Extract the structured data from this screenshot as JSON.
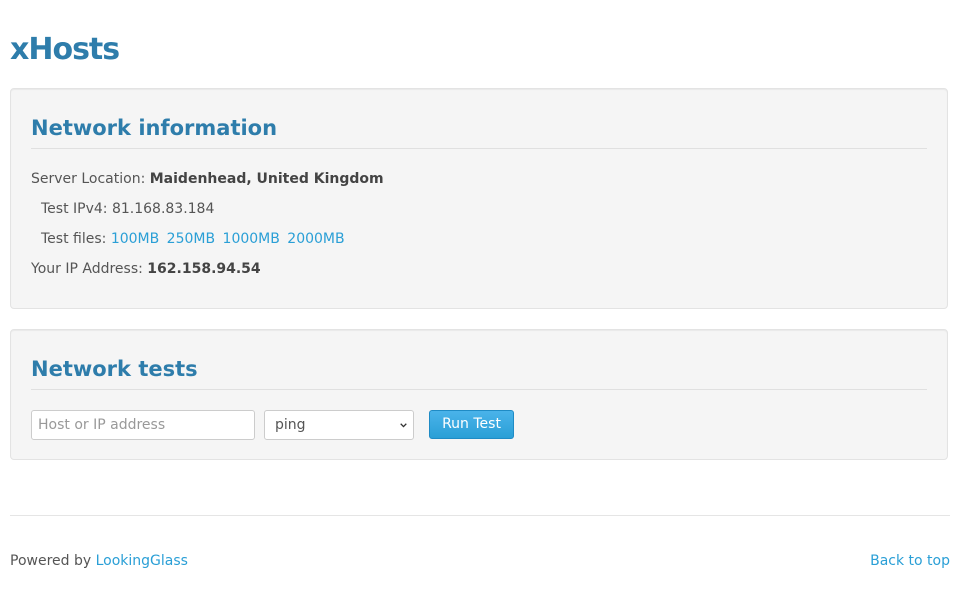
{
  "brand": {
    "logo_text": "xHosts",
    "color": "#2e7dab"
  },
  "network_info": {
    "title": "Network information",
    "server_location_label": "Server Location:",
    "server_location_value": "Maidenhead, United Kingdom",
    "test_ipv4_label": "Test IPv4:",
    "test_ipv4_value": "81.168.83.184",
    "test_files_label": "Test files:",
    "test_files": [
      "100MB",
      "250MB",
      "1000MB",
      "2000MB"
    ],
    "your_ip_label": "Your IP Address:",
    "your_ip_value": "162.158.94.54"
  },
  "network_tests": {
    "title": "Network tests",
    "host_placeholder": "Host or IP address",
    "host_value": "",
    "test_type_selected": "ping",
    "run_button_label": "Run Test"
  },
  "footer": {
    "powered_by_prefix": "Powered by",
    "powered_by_link": "LookingGlass",
    "back_to_top": "Back to top"
  },
  "colors": {
    "accent": "#2a9fd6",
    "heading": "#2e7dab",
    "panel_bg": "#f5f5f5"
  }
}
